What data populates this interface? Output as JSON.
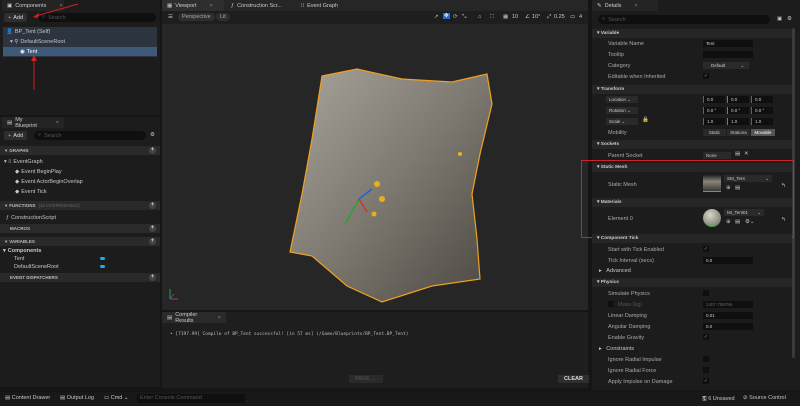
{
  "components": {
    "tab": "Components",
    "add": "Add",
    "search_placeholder": "Search",
    "tree": [
      "BP_Tent (Self)",
      "DefaultSceneRoot",
      "Tent"
    ]
  },
  "my_blueprint": {
    "tab": "My Blueprint",
    "add": "Add",
    "search_placeholder": "Search",
    "graphs_header": "GRAPHS",
    "event_graph": "EventGraph",
    "events": [
      "Event BeginPlay",
      "Event ActorBeginOverlap",
      "Event Tick"
    ],
    "functions_header": "FUNCTIONS",
    "functions_note": "(16 OVERRIDABLE)",
    "construction_script": "ConstructionScript",
    "macros_header": "MACROS",
    "variables_header": "VARIABLES",
    "components_group": "Components",
    "variables": [
      "Tent",
      "DefaultSceneRoot"
    ],
    "dispatchers_header": "EVENT DISPATCHERS",
    "variable_color": "#2aa8e0"
  },
  "viewport": {
    "tabs": [
      "Viewport",
      "Construction Scr...",
      "Event Graph"
    ],
    "perspective": "Perspective",
    "lit": "Lit",
    "grid_snap": "10",
    "rot_snap": "10°",
    "scale_snap": "0.25",
    "cam_speed": "4",
    "mesh_color": "#8a8680",
    "outline_color": "#f0a020"
  },
  "compiler": {
    "tab": "Compiler Results",
    "message": "[7197.99] Compile of BP_Tent successful! [in 57 ms] (/Game/Blueprints/BP_Tent.BP_Tent)",
    "page": "PAGE ←",
    "clear": "CLEAR"
  },
  "details": {
    "tab": "Details",
    "search_placeholder": "Search",
    "variable": {
      "header": "Variable",
      "name_label": "Variable Name",
      "name_value": "Tent",
      "tooltip_label": "Tooltip",
      "category_label": "Category",
      "category_value": "Default",
      "editable_label": "Editable when Inherited"
    },
    "transform": {
      "header": "Transform",
      "location": "Location",
      "rotation": "Rotation",
      "scale": "Scale",
      "loc": [
        "0.0",
        "0.0",
        "0.0"
      ],
      "rot": [
        "0.0 °",
        "0.0 °",
        "0.0 °"
      ],
      "scl": [
        "1.0",
        "1.0",
        "1.0"
      ],
      "mobility_label": "Mobility",
      "mobility": [
        "Static",
        "Stationa",
        "Movable"
      ]
    },
    "sockets": {
      "header": "Sockets",
      "parent_label": "Parent Socket",
      "parent_value": "None"
    },
    "static_mesh": {
      "header": "Static Mesh",
      "label": "Static Mesh",
      "value": "SM_Tent"
    },
    "materials": {
      "header": "Materials",
      "label": "Element 0",
      "value": "MI_Tent01"
    },
    "tick": {
      "header": "Component Tick",
      "start_label": "Start with Tick Enabled",
      "interval_label": "Tick Interval (secs)",
      "interval_value": "0.0",
      "advanced": "Advanced"
    },
    "physics": {
      "header": "Physics",
      "simulate": "Simulate Physics",
      "mass_label": "Mass (kg)",
      "mass_value": "1407.758756",
      "linear_label": "Linear Damping",
      "linear_value": "0.01",
      "angular_label": "Angular Damping",
      "angular_value": "0.0",
      "gravity": "Enable Gravity",
      "constraints": "Constraints",
      "radial_impulse": "Ignore Radial Impulse",
      "radial_force": "Ignore Radial Force",
      "apply_impulse": "Apply Impulse on Damage"
    },
    "highlight_color": "#d0202a"
  },
  "statusbar": {
    "content_drawer": "Content Drawer",
    "output_log": "Output Log",
    "cmd": "Cmd",
    "console_placeholder": "Enter Console Command",
    "unsaved": "6 Unsaved",
    "source_control": "Source Control"
  }
}
